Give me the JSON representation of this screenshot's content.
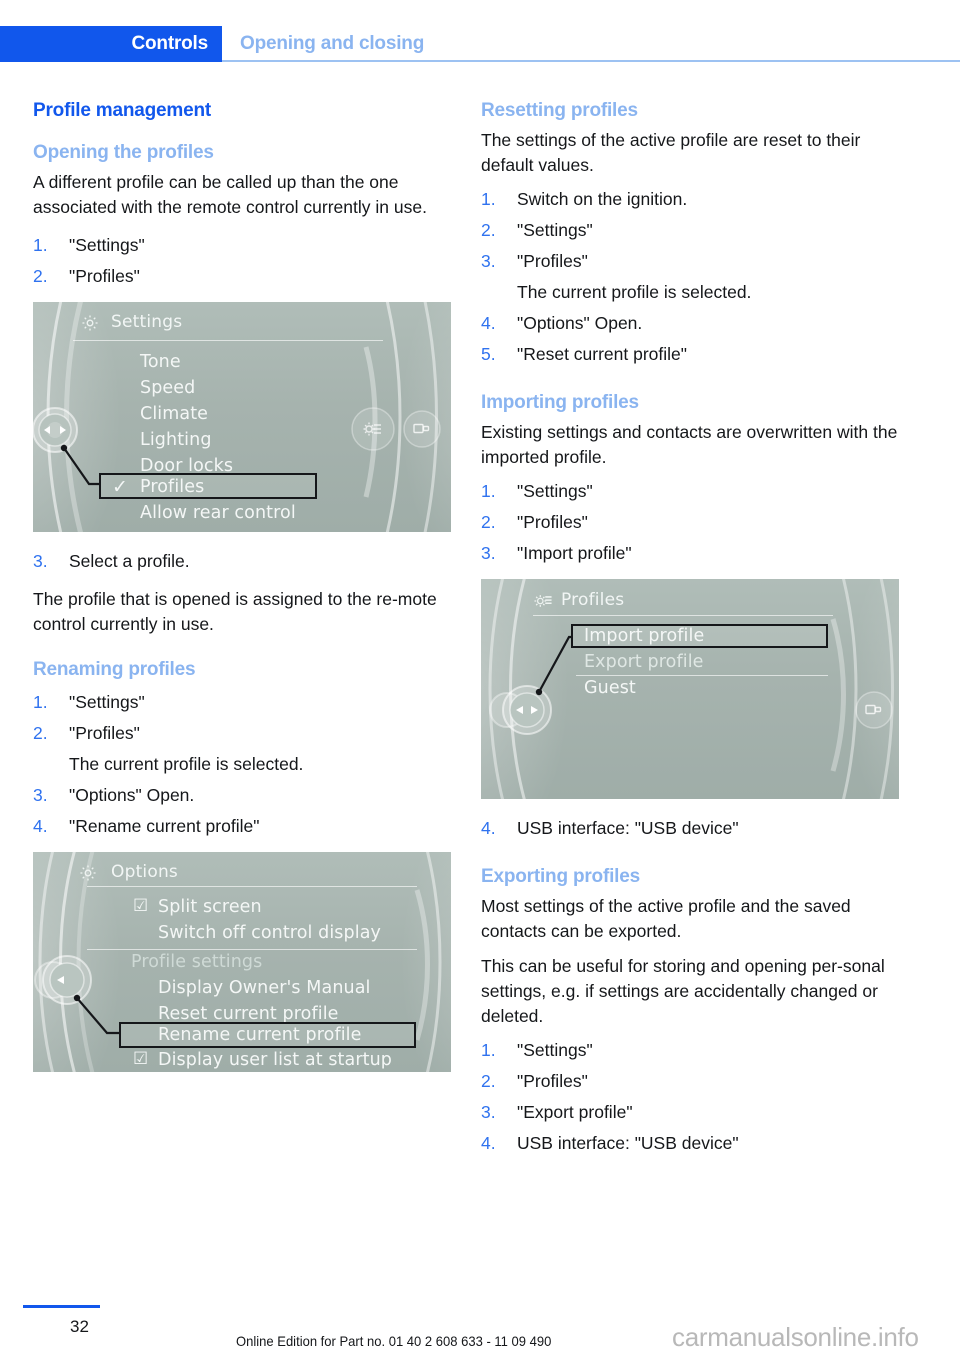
{
  "header": {
    "tab_label": "Controls",
    "section_label": "Opening and closing",
    "accent": "#1157ec",
    "section_color": "#8ab4f0"
  },
  "left_column": {
    "title": "Profile management",
    "sections": [
      {
        "heading": "Opening the profiles",
        "paragraphs": [
          "A different profile can be called up than the one associated with the remote control currently in use."
        ],
        "steps": [
          {
            "num": "1.",
            "text": "\"Settings\""
          },
          {
            "num": "2.",
            "text": "\"Profiles\""
          }
        ]
      },
      {
        "steps_after_image": [
          {
            "num": "3.",
            "text": "Select a profile."
          }
        ],
        "paragraph_after": "The profile that is opened is assigned to the re-mote control currently in use."
      },
      {
        "heading": "Renaming profiles",
        "steps": [
          {
            "num": "1.",
            "text": "\"Settings\""
          },
          {
            "num": "2.",
            "text": "\"Profiles\"",
            "note": "The current profile is selected."
          },
          {
            "num": "3.",
            "text": "\"Options\" Open."
          },
          {
            "num": "4.",
            "text": "\"Rename current profile\""
          }
        ]
      }
    ]
  },
  "right_column": {
    "sections": [
      {
        "heading": "Resetting profiles",
        "paragraphs": [
          "The settings of the active profile are reset to their default values."
        ],
        "steps": [
          {
            "num": "1.",
            "text": "Switch on the ignition."
          },
          {
            "num": "2.",
            "text": "\"Settings\""
          },
          {
            "num": "3.",
            "text": "\"Profiles\"",
            "note": "The current profile is selected."
          },
          {
            "num": "4.",
            "text": "\"Options\" Open."
          },
          {
            "num": "5.",
            "text": "\"Reset current profile\""
          }
        ]
      },
      {
        "heading": "Importing profiles",
        "paragraphs": [
          "Existing settings and contacts are overwritten with the imported profile."
        ],
        "steps": [
          {
            "num": "1.",
            "text": "\"Settings\""
          },
          {
            "num": "2.",
            "text": "\"Profiles\""
          },
          {
            "num": "3.",
            "text": "\"Import profile\""
          }
        ],
        "steps_after_image": [
          {
            "num": "4.",
            "text": "USB interface: \"USB device\""
          }
        ]
      },
      {
        "heading": "Exporting profiles",
        "paragraphs": [
          "Most settings of the active profile and the saved contacts can be exported.",
          "This can be useful for storing and opening per-sonal settings, e.g. if settings are accidentally changed or deleted."
        ],
        "steps": [
          {
            "num": "1.",
            "text": "\"Settings\""
          },
          {
            "num": "2.",
            "text": "\"Profiles\""
          },
          {
            "num": "3.",
            "text": "\"Export profile\""
          },
          {
            "num": "4.",
            "text": "USB interface: \"USB device\""
          }
        ]
      }
    ]
  },
  "screenshots": {
    "settings_menu": {
      "header_title": "Settings",
      "header_icon": "gear-icon",
      "items": [
        {
          "label": "Tone"
        },
        {
          "label": "Speed"
        },
        {
          "label": "Climate"
        },
        {
          "label": "Lighting"
        },
        {
          "label": "Door locks"
        },
        {
          "label": "Profiles",
          "checked": true,
          "highlighted": true
        },
        {
          "label": "Allow rear control"
        }
      ],
      "right_icons": [
        "gear-list-icon",
        "display-icon"
      ],
      "background": "#a9b6b1"
    },
    "options_menu": {
      "header_title": "Options",
      "header_icon": "gear-icon",
      "items": [
        {
          "label": "Split screen",
          "checkbox": true
        },
        {
          "label": "Switch off control display"
        },
        {
          "label": "Profile settings",
          "is_group_label": true
        },
        {
          "label": "Display Owner's Manual"
        },
        {
          "label": "Reset current profile"
        },
        {
          "label": "Rename current profile",
          "highlighted": true
        },
        {
          "label": "Display user list at startup",
          "checkbox": true
        }
      ],
      "background": "#a9b6b1"
    },
    "profiles_menu": {
      "header_title": "Profiles",
      "header_icon": "gear-list-icon",
      "items": [
        {
          "label": "Import profile",
          "highlighted": true
        },
        {
          "label": "Export profile"
        },
        {
          "label": "Guest"
        }
      ],
      "right_icons": [
        "display-icon"
      ],
      "background": "#a9b6b1"
    }
  },
  "footer": {
    "page_number": "32",
    "edition_text": "Online Edition for Part no. 01 40 2 608 633 - 11 09 490",
    "watermark": "carmanualsonline.info"
  }
}
